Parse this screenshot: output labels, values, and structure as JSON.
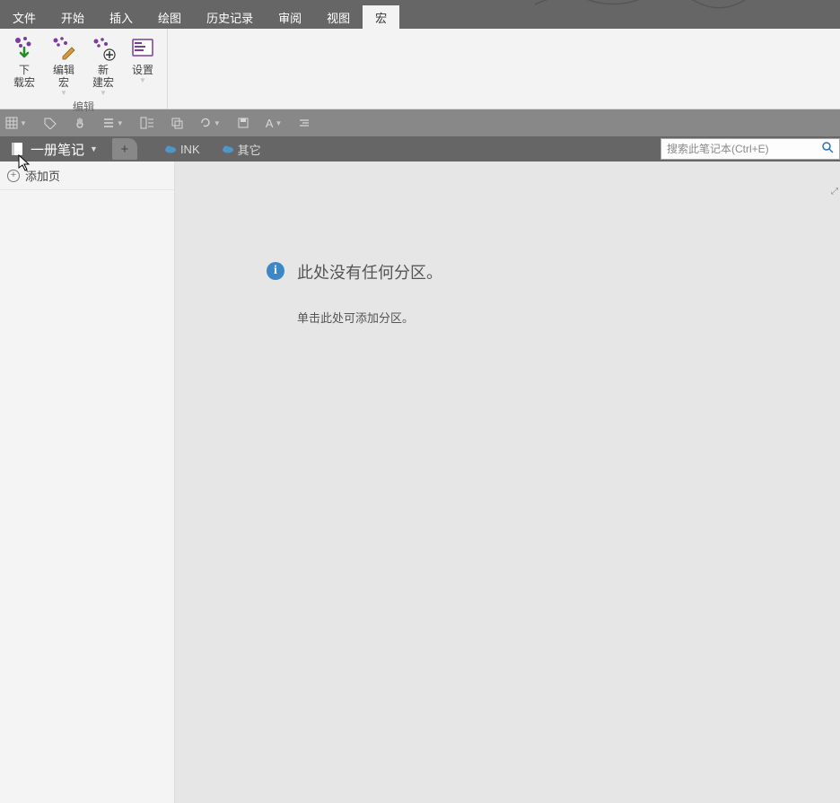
{
  "menu": {
    "file": "文件",
    "start": "开始",
    "insert": "插入",
    "draw": "绘图",
    "history": "历史记录",
    "review": "审阅",
    "view": "视图",
    "macro": "宏"
  },
  "ribbon": {
    "download": "下\n载宏",
    "edit": "编辑\n宏",
    "new": "新\n建宏",
    "settings": "设置",
    "group_label": "编辑"
  },
  "toolbar": {
    "format_a": "A"
  },
  "notebook": {
    "name": "一册笔记"
  },
  "sections": {
    "ink": "INK",
    "other": "其它"
  },
  "search": {
    "placeholder": "搜索此笔记本(Ctrl+E)"
  },
  "sidebar": {
    "add_page": "添加页"
  },
  "empty": {
    "title": "此处没有任何分区。",
    "sub": "单击此处可添加分区。"
  }
}
